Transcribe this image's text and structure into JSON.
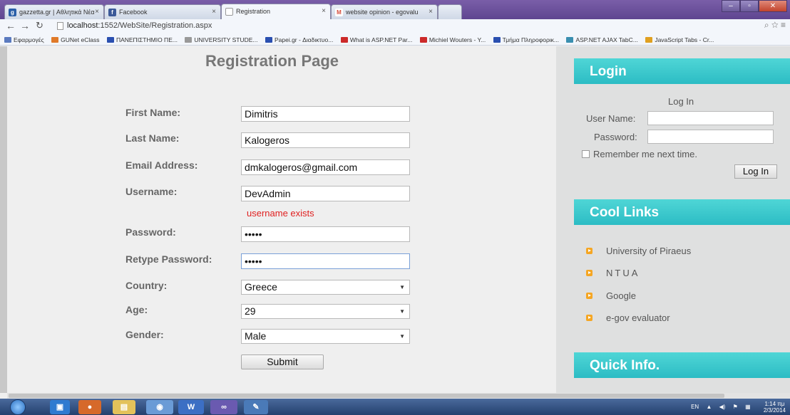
{
  "browser": {
    "tabs": [
      {
        "label": "gazzetta.gr | Αθλητικά Νέα",
        "icon_color": "#2a5fa8",
        "icon_text": "g"
      },
      {
        "label": "Facebook",
        "icon_color": "#3b5998",
        "icon_text": "f"
      },
      {
        "label": "Registration",
        "icon_color": "#ffffff",
        "icon_text": ""
      },
      {
        "label": "website opinion - egovalu",
        "icon_color": "#d44b3a",
        "icon_text": "M"
      }
    ],
    "url_host": "localhost",
    "url_rest": ":1552/WebSite/Registration.aspx",
    "bookmarks": [
      {
        "label": "Εφαρμογές",
        "color": "#5a7abf"
      },
      {
        "label": "GUNet eClass",
        "color": "#e07a2a"
      },
      {
        "label": "ΠΑΝΕΠΙΣΤΗΜΙΟ ΠΕ...",
        "color": "#2a4fb0"
      },
      {
        "label": "UNIVERSITY STUDE...",
        "color": "#999999"
      },
      {
        "label": "Papei.gr - Διαδικτυο...",
        "color": "#2a4fb0"
      },
      {
        "label": "What is ASP.NET Par...",
        "color": "#cc2a2a"
      },
      {
        "label": "Michiel Wouters - Y...",
        "color": "#cc2a2a"
      },
      {
        "label": "Τμήμα Πληροφορικ...",
        "color": "#2a4fb0"
      },
      {
        "label": "ASP.NET AJAX TabC...",
        "color": "#3a8fb0"
      },
      {
        "label": "JavaScript Tabs - Cr...",
        "color": "#e0a020"
      }
    ]
  },
  "form": {
    "title": "Registration Page",
    "fields": {
      "first_name": {
        "label": "First Name:",
        "value": "Dimitris"
      },
      "last_name": {
        "label": "Last Name:",
        "value": "Kalogeros"
      },
      "email": {
        "label": "Email Address:",
        "value": "dmkalogeros@gmail.com"
      },
      "username": {
        "label": "Username:",
        "value": "DevAdmin"
      },
      "password": {
        "label": "Password:",
        "value": "•••••"
      },
      "retype": {
        "label": "Retype Password:",
        "value": "•••••"
      },
      "country": {
        "label": "Country:",
        "value": "Greece"
      },
      "age": {
        "label": "Age:",
        "value": "29"
      },
      "gender": {
        "label": "Gender:",
        "value": "Male"
      }
    },
    "error": "username exists",
    "submit_label": "Submit"
  },
  "sidebar": {
    "login": {
      "heading": "Login",
      "caption": "Log In",
      "username_label": "User Name:",
      "password_label": "Password:",
      "remember_label": "Remember me next time.",
      "button_label": "Log In"
    },
    "links": {
      "heading": "Cool Links",
      "items": [
        "University of Piraeus",
        "NTUA",
        "Google",
        "e-gov evaluator"
      ]
    },
    "quick_info": {
      "heading": "Quick Info."
    }
  },
  "taskbar": {
    "lang": "EN",
    "time": "1:14 πμ",
    "date": "2/3/2014"
  },
  "colors": {
    "accent_teal": "#2cbcc4",
    "error_red": "#e02020",
    "bullet_orange": "#f5a623"
  }
}
